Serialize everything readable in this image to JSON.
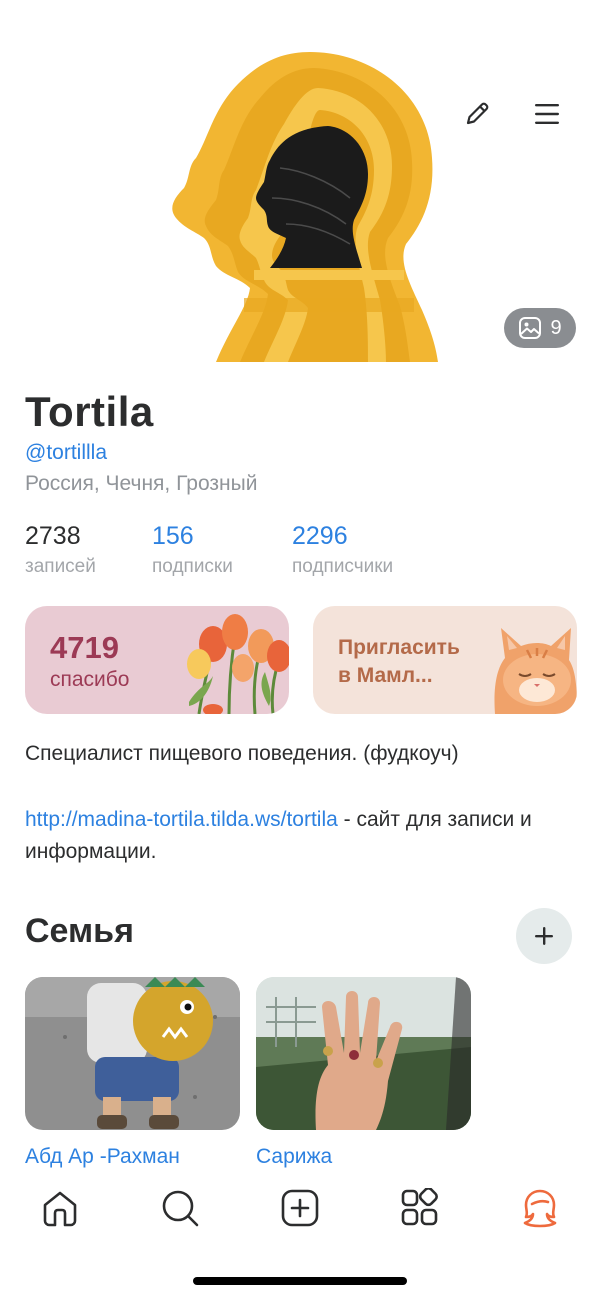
{
  "profile": {
    "name": "Tortila",
    "username": "@tortillla",
    "location": "Россия, Чечня, Грозный",
    "photos_count": "9"
  },
  "stats": [
    {
      "value": "2738",
      "label": "записей"
    },
    {
      "value": "156",
      "label": "подписки"
    },
    {
      "value": "2296",
      "label": "подписчики"
    }
  ],
  "cards": {
    "thanks": {
      "count": "4719",
      "label": "спасибо"
    },
    "invite": {
      "label": "Пригласить в Мамл..."
    }
  },
  "bio": {
    "text": "Специалист пищевого поведения. (фудкоуч)",
    "link": "http://madina-tortila.tilda.ws/tortila",
    "link_suffix": " - сайт для записи и информации."
  },
  "family": {
    "title": "Семья",
    "members": [
      {
        "name": "Абд Ар -Рахман"
      },
      {
        "name": "Сарижа"
      }
    ]
  },
  "icons": {
    "edit": "pencil-icon",
    "menu": "hamburger-icon",
    "photos": "image-icon",
    "add": "plus-icon",
    "tabs": [
      "home-icon",
      "search-icon",
      "add-post-icon",
      "services-icon",
      "profile-icon"
    ]
  },
  "colors": {
    "accent_blue": "#2d81e0",
    "thanks_text": "#9c3a55",
    "invite_text": "#b46a49",
    "active_tab": "#ee6a3d",
    "avatar_yellow": "#f2b632"
  }
}
